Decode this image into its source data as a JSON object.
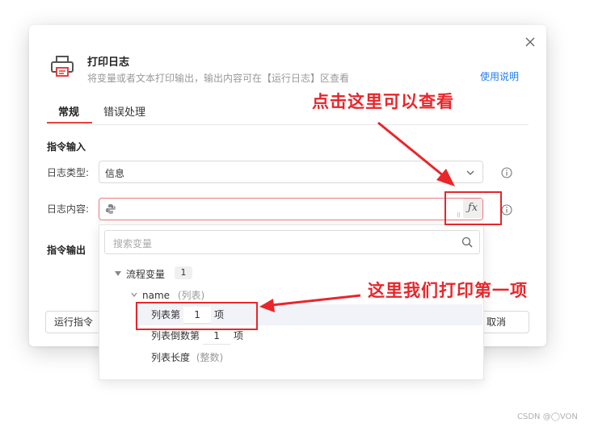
{
  "dialog": {
    "title": "打印日志",
    "subtitle": "将变量或者文本打印输出，输出内容可在【运行日志】区查看",
    "help_link": "使用说明",
    "tabs": [
      {
        "label": "常规"
      },
      {
        "label": "错误处理"
      }
    ],
    "section_input": "指令输入",
    "section_output": "指令输出",
    "log_type": {
      "label": "日志类型:",
      "value": "信息"
    },
    "log_content": {
      "label": "日志内容:",
      "value": ""
    },
    "footer": {
      "run_label": "运行指令",
      "cancel_label": "取消"
    }
  },
  "dropdown": {
    "search_placeholder": "搜索变量",
    "group": {
      "label": "流程变量",
      "count": "1"
    },
    "variable": {
      "name": "name",
      "type": "(列表)"
    },
    "items": [
      {
        "prefix": "列表第",
        "value": "1",
        "suffix": "项"
      },
      {
        "prefix": "列表倒数第",
        "value": "1",
        "suffix": "项"
      },
      {
        "prefix": "列表长度",
        "type": "(整数)"
      }
    ]
  },
  "annotations": {
    "top": "点击这里可以查看",
    "middle": "这里我们打印第一项"
  },
  "watermark": "CSDN @◯VON",
  "colors": {
    "accent": "#e3413d",
    "link": "#1e7ef0",
    "annotation": "#e8262b"
  }
}
